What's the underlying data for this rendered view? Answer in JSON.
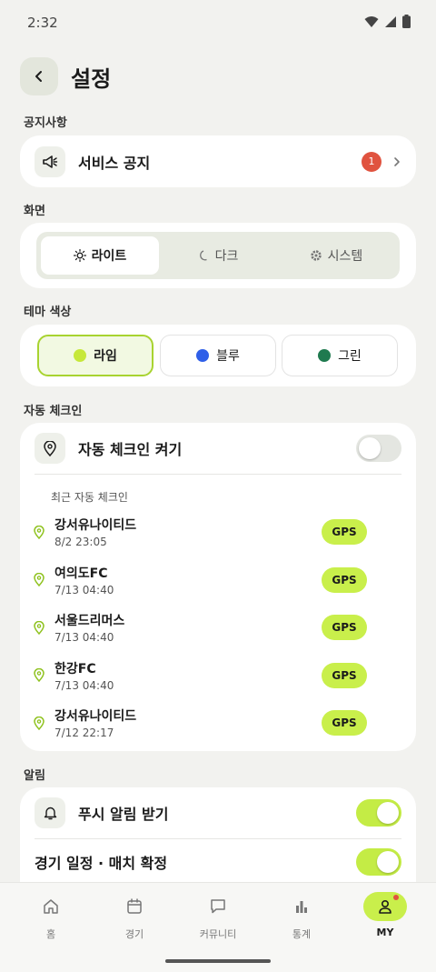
{
  "status_bar": {
    "time": "2:32"
  },
  "header": {
    "title": "설정"
  },
  "notices": {
    "section": "공지사항",
    "service_notice": {
      "label": "서비스 공지",
      "badge": "1"
    }
  },
  "display": {
    "section": "화면",
    "options": [
      "라이트",
      "다크",
      "시스템"
    ],
    "selected": "라이트"
  },
  "theme": {
    "section": "테마 색상",
    "options": [
      {
        "label": "라임",
        "color": "#c6e83a"
      },
      {
        "label": "블루",
        "color": "#2f5fe8"
      },
      {
        "label": "그린",
        "color": "#1f7a4f"
      }
    ],
    "selected": "라임"
  },
  "auto_checkin": {
    "section": "자동 체크인",
    "toggle_label": "자동 체크인 켜기",
    "toggle_on": false,
    "recent_title": "최근 자동 체크인",
    "items": [
      {
        "name": "강서유나이티드",
        "date": "8/2 23:05",
        "badge": "GPS"
      },
      {
        "name": "여의도FC",
        "date": "7/13 04:40",
        "badge": "GPS"
      },
      {
        "name": "서울드리머스",
        "date": "7/13 04:40",
        "badge": "GPS"
      },
      {
        "name": "한강FC",
        "date": "7/13 04:40",
        "badge": "GPS"
      },
      {
        "name": "강서유나이티드",
        "date": "7/12 22:17",
        "badge": "GPS"
      }
    ]
  },
  "alerts": {
    "section": "알림",
    "push_label": "푸시 알림 받기",
    "push_on": true,
    "match_label": "경기 일정 · 매치 확정",
    "match_on": true
  },
  "bottom_nav": {
    "items": [
      "홈",
      "경기",
      "커뮤니티",
      "통계",
      "MY"
    ],
    "active": "MY"
  },
  "colors": {
    "accent": "#c9ef4b",
    "badge": "#e0533f",
    "background": "#f2f2ef"
  }
}
